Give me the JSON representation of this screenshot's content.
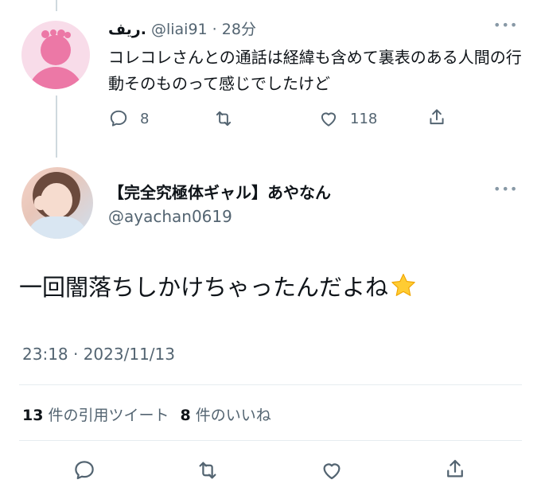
{
  "reply": {
    "name": "ريف.",
    "handle": "@liai91",
    "separator": "·",
    "time": "28分",
    "text": "コレコレさんとの通話は経緯も含めて裏表のある人間の行動そのものって感じでしたけど",
    "more_icon": "more-icon",
    "actions": {
      "reply_count": "8",
      "retweet_count": "",
      "like_count": "118"
    }
  },
  "tweet": {
    "name": "【完全究極体ギャル】あやなん",
    "handle": "@ayachan0619",
    "text": "一回闇落ちしかけちゃったんだよね",
    "emoji": "star-emoji",
    "timestamp": "23:18 · 2023/11/13",
    "quote_count": "13",
    "quote_label": "件の引用ツイート",
    "like_count": "8",
    "like_label": "件のいいね"
  },
  "colors": {
    "text": "#0f1419",
    "secondary": "#536471",
    "divider": "#e6ecf0",
    "avatar_pink": "#ec78a6"
  }
}
